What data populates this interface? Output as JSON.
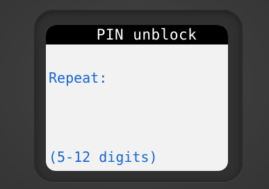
{
  "screen": {
    "title": "PIN unblock",
    "prompt": "Repeat:",
    "hint": "(5-12 digits)"
  },
  "colors": {
    "background": "#3e3e3e",
    "bezel": "#303030",
    "screen": "#f2f2f2",
    "title_bar": "#000000",
    "title_text": "#ffffff",
    "accent_text": "#1565d8"
  }
}
